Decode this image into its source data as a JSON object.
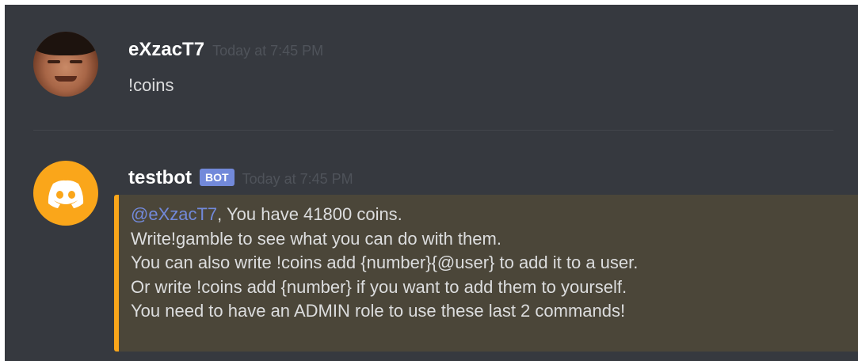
{
  "messages": [
    {
      "author": "eXzacT7",
      "timestamp": "Today at 7:45 PM",
      "text": "!coins"
    },
    {
      "author": "testbot",
      "badge": "BOT",
      "timestamp": "Today at 7:45 PM",
      "embed": {
        "mention": "@eXzacT7",
        "first_line_rest": ", You have 41800 coins.",
        "lines": [
          "Write!gamble to see what you can do with them.",
          "You can also write !coins add {number}{@user} to add it to a user.",
          "Or write !coins add {number} if you want to add them to yourself.",
          "You need to have an ADMIN role to use these last 2 commands!"
        ],
        "accent_color": "#faa61a"
      }
    }
  ],
  "colors": {
    "background": "#36393f",
    "mention": "#7289da",
    "bot_badge": "#7289da",
    "bot_avatar": "#faa61a"
  },
  "icons": {
    "bot_avatar": "discord-logo-icon"
  }
}
